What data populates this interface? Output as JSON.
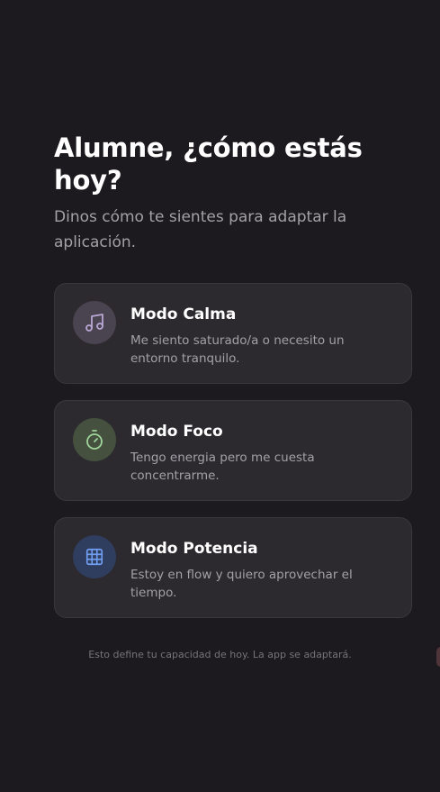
{
  "header": {
    "title": "Alumne, ¿cómo estás hoy?",
    "subtitle": "Dinos cómo te sientes para adaptar la aplicación."
  },
  "modes": [
    {
      "title": "Modo Calma",
      "description": "Me siento saturado/a o necesito un entorno tranquilo.",
      "icon": "music-note-icon",
      "icon_color": "#b9a7d6",
      "icon_bg": "#4a4350"
    },
    {
      "title": "Modo Foco",
      "description": "Tengo energia pero me cuesta concentrarme.",
      "icon": "stopwatch-icon",
      "icon_color": "#9fd49a",
      "icon_bg": "#45503f"
    },
    {
      "title": "Modo Potencia",
      "description": "Estoy en flow y quiero aprovechar el tiempo.",
      "icon": "grid-icon",
      "icon_color": "#6f9ef2",
      "icon_bg": "#2f3d5e"
    }
  ],
  "footer": {
    "note": "Esto define tu capacidad de hoy. La app se adaptará."
  },
  "colors": {
    "background": "#1c1a1e",
    "card": "#2c2a2f",
    "text_primary": "#ffffff",
    "text_secondary": "#a3a1a8",
    "text_muted": "#75737a"
  }
}
